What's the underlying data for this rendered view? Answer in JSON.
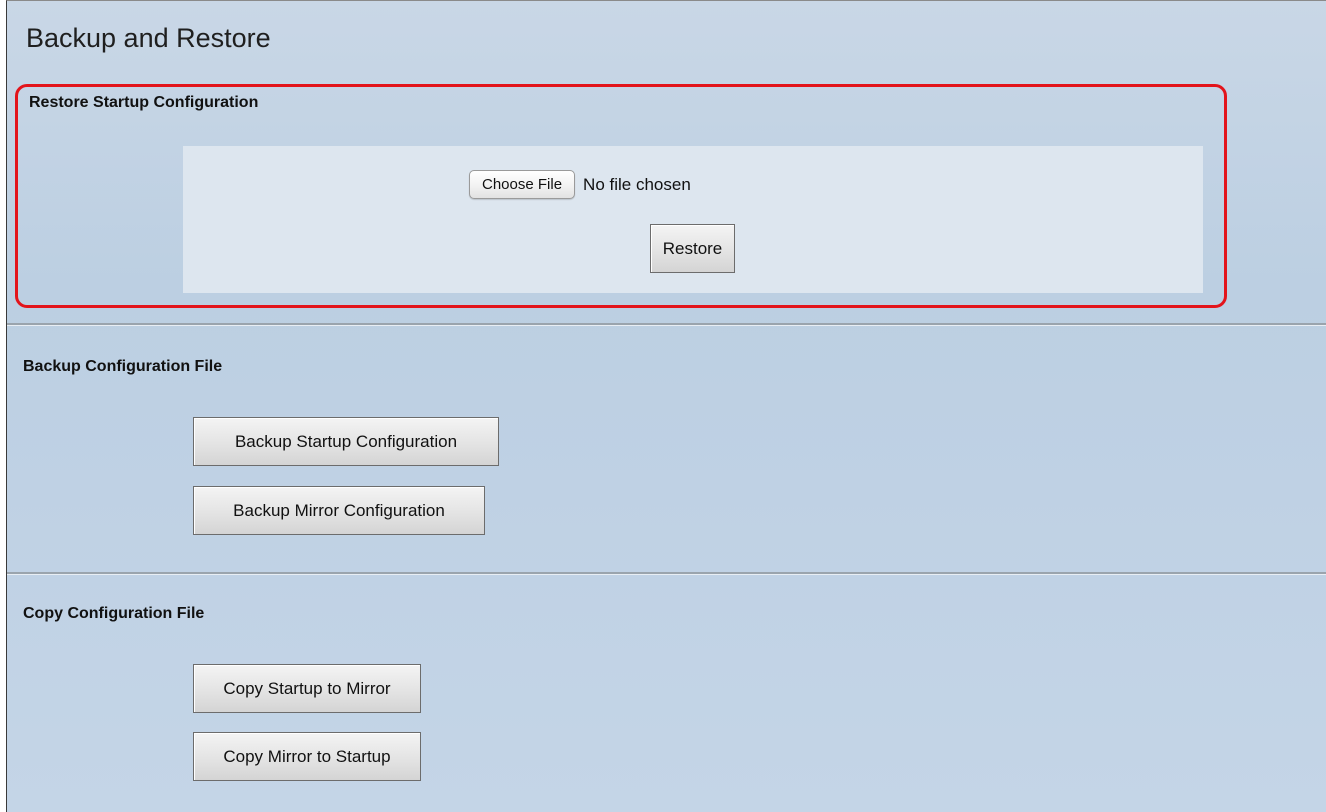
{
  "page": {
    "title": "Backup and Restore"
  },
  "restore_section": {
    "title": "Restore Startup Configuration",
    "choose_file_label": "Choose File",
    "file_status": "No file chosen",
    "restore_label": "Restore"
  },
  "backup_section": {
    "title": "Backup Configuration File",
    "backup_startup_label": "Backup Startup Configuration",
    "backup_mirror_label": "Backup Mirror Configuration"
  },
  "copy_section": {
    "title": "Copy Configuration File",
    "copy_startup_to_mirror_label": "Copy Startup to Mirror",
    "copy_mirror_to_startup_label": "Copy Mirror to Startup"
  },
  "colors": {
    "page_background": "#bfd1e4",
    "highlight_border": "#e3141b",
    "panel_background": "#dde6ef"
  }
}
